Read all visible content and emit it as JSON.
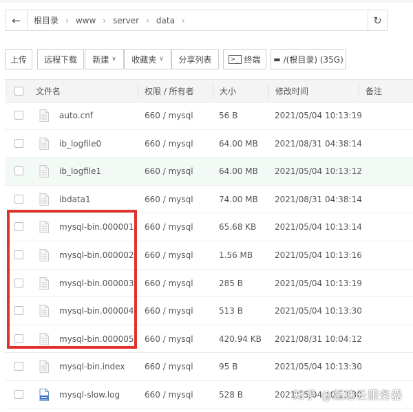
{
  "breadcrumb": [
    "根目录",
    "www",
    "server",
    "data"
  ],
  "toolbar": {
    "upload": "上传",
    "remote_download": "远程下载",
    "new": "新建",
    "favorites": "收藏夹",
    "share_list": "分享列表",
    "terminal": "终端",
    "disk": "/(根目录) (35G)"
  },
  "columns": {
    "name": "文件名",
    "perm": "权限 / 所有者",
    "size": "大小",
    "mtime": "修改时间",
    "note": "备注"
  },
  "files": [
    {
      "name": "auto.cnf",
      "perm": "660 / mysql",
      "size": "56 B",
      "mtime": "2021/05/04 10:13:19",
      "icon": "file-icon"
    },
    {
      "name": "ib_logfile0",
      "perm": "660 / mysql",
      "size": "64.00 MB",
      "mtime": "2021/08/31 04:38:14",
      "icon": "file-icon"
    },
    {
      "name": "ib_logfile1",
      "perm": "660 / mysql",
      "size": "64.00 MB",
      "mtime": "2021/05/04 10:13:12",
      "icon": "file-icon"
    },
    {
      "name": "ibdata1",
      "perm": "660 / mysql",
      "size": "74.00 MB",
      "mtime": "2021/08/31 04:38:14",
      "icon": "file-icon"
    },
    {
      "name": "mysql-bin.000001",
      "perm": "660 / mysql",
      "size": "65.68 KB",
      "mtime": "2021/05/04 10:13:14",
      "icon": "file-icon"
    },
    {
      "name": "mysql-bin.000002",
      "perm": "660 / mysql",
      "size": "1.56 MB",
      "mtime": "2021/05/04 10:13:16",
      "icon": "file-icon"
    },
    {
      "name": "mysql-bin.000003",
      "perm": "660 / mysql",
      "size": "285 B",
      "mtime": "2021/05/04 10:13:19",
      "icon": "file-icon"
    },
    {
      "name": "mysql-bin.000004",
      "perm": "660 / mysql",
      "size": "513 B",
      "mtime": "2021/05/04 10:13:30",
      "icon": "file-icon"
    },
    {
      "name": "mysql-bin.000005",
      "perm": "660 / mysql",
      "size": "420.94 KB",
      "mtime": "2021/08/31 10:04:12",
      "icon": "file-icon"
    },
    {
      "name": "mysql-bin.index",
      "perm": "660 / mysql",
      "size": "95 B",
      "mtime": "2021/05/04 10:13:30",
      "icon": "file-icon"
    },
    {
      "name": "mysql-slow.log",
      "perm": "660 / mysql",
      "size": "528 B",
      "mtime": "2021/05/04 10:13:30",
      "icon": "log-file-icon"
    }
  ],
  "highlighted_row": 2,
  "watermark": "知乎 @燃速云服务器",
  "colors": {
    "highlight_box": "#e0312d",
    "row_hover": "#f3faf6"
  }
}
